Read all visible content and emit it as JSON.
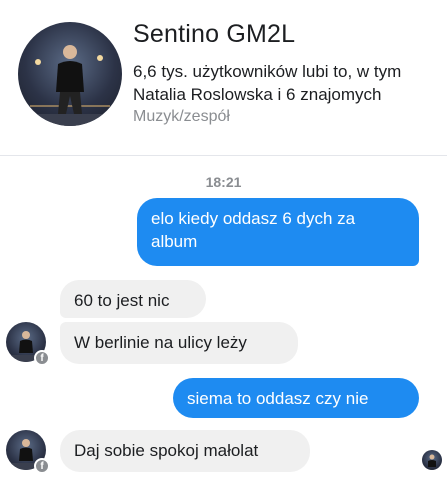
{
  "header": {
    "page_name": "Sentino GM2L",
    "likes_text": "6,6 tys. użytkowników lubi to, w tym Natalia Roslowska i 6 znajomych",
    "category": "Muzyk/zespół"
  },
  "conversation": {
    "timestamp": "18:21",
    "messages": [
      {
        "direction": "outgoing",
        "text": "elo kiedy oddasz 6 dych za album"
      },
      {
        "direction": "incoming",
        "text": "60 to jest nic"
      },
      {
        "direction": "incoming",
        "text": "W berlinie na ulicy leży"
      },
      {
        "direction": "outgoing",
        "text": "siema to oddasz czy nie"
      },
      {
        "direction": "incoming",
        "text": "Daj sobie spokoj małolat"
      }
    ]
  },
  "icons": {
    "messenger_badge": "f",
    "profile_picture": "profile-photo-icon",
    "seen_indicator": "seen-avatar-icon"
  },
  "colors": {
    "outgoing_bubble": "#1e8bf1",
    "incoming_bubble": "#f0f0f0",
    "secondary_text": "#8a8d91"
  }
}
